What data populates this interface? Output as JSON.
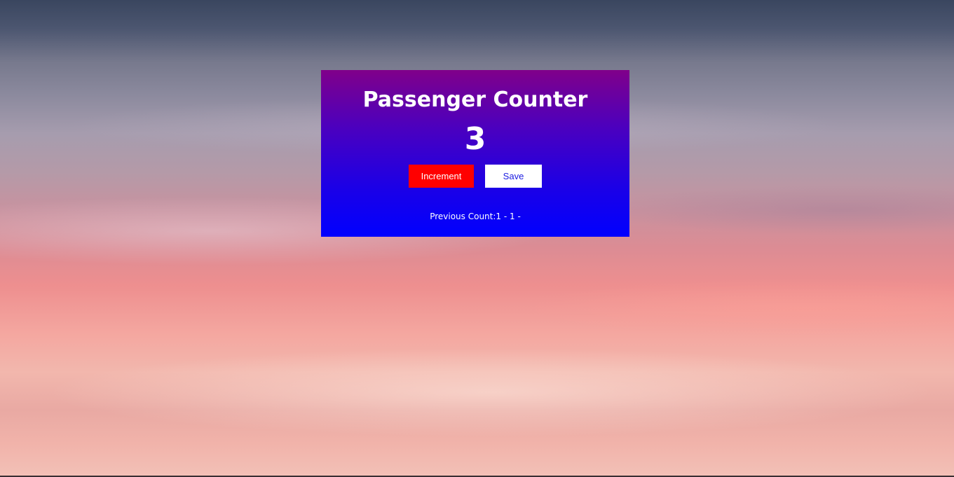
{
  "counter": {
    "title": "Passenger Counter",
    "count": "3",
    "increment_label": "Increment",
    "save_label": "Save",
    "previous_label": "Previous Count:",
    "previous_entries": "1 - 1 -"
  },
  "colors": {
    "card_top": "#80008a",
    "card_bottom": "#0000ff",
    "increment_button": "#ff0000",
    "save_button": "#ffffff",
    "save_text": "#1a1ae0"
  }
}
